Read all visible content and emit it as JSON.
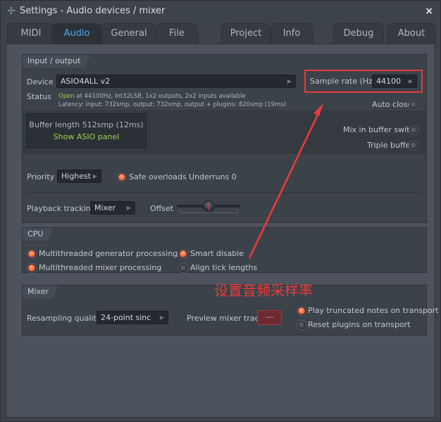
{
  "window": {
    "title": "Settings - Audio devices / mixer",
    "close_icon": "×",
    "app_icon": "✢"
  },
  "tabs": [
    {
      "label": "MIDI",
      "active": false
    },
    {
      "label": "Audio",
      "active": true
    },
    {
      "label": "General",
      "active": false
    },
    {
      "label": "File",
      "active": false
    },
    {
      "label": "Project",
      "active": false
    },
    {
      "label": "Info",
      "active": false
    },
    {
      "label": "Debug",
      "active": false
    },
    {
      "label": "About",
      "active": false
    }
  ],
  "input_output": {
    "section_label": "Input / output",
    "device_label": "Device",
    "device_value": "ASIO4ALL v2",
    "sample_rate_label": "Sample rate (Hz)",
    "sample_rate_value": "44100",
    "status_label": "Status",
    "status_open": "Open",
    "status_line1_rest": " at 44100Hz, Int32LSB, 1x2 outputs, 2x2 inputs available",
    "status_line2": "Latency: input: 732smp, output: 732smp, output + plugins: 820smp (19ms)",
    "auto_close_label": "Auto close",
    "auto_close_on": false,
    "buffer_length_label": "Buffer length 512smp (12ms)",
    "show_asio_panel_label": "Show ASIO panel",
    "mix_in_buffer_switch_label": "Mix in buffer switch",
    "mix_in_buffer_switch_on": false,
    "triple_buffer_label": "Triple buffer",
    "triple_buffer_on": false,
    "priority_label": "Priority",
    "priority_value": "Highest",
    "safe_overloads_label": "Safe overloads",
    "safe_overloads_on": true,
    "underruns_label": "Underruns 0",
    "playback_tracking_label": "Playback tracking",
    "playback_tracking_value": "Mixer",
    "offset_label": "Offset",
    "offset_value_fraction": 0.5
  },
  "cpu": {
    "section_label": "CPU",
    "options": [
      {
        "label": "Multithreaded generator processing",
        "on": true
      },
      {
        "label": "Multithreaded mixer processing",
        "on": true
      },
      {
        "label": "Smart disable",
        "on": true
      },
      {
        "label": "Align tick lengths",
        "on": false
      }
    ]
  },
  "mixer": {
    "section_label": "Mixer",
    "resampling_quality_label": "Resampling quality",
    "resampling_quality_value": "24-point sinc",
    "preview_mixer_track_label": "Preview mixer track",
    "preview_mixer_track_value": "---",
    "play_truncated_label": "Play truncated notes on transport",
    "play_truncated_on": true,
    "reset_plugins_label": "Reset plugins on transport",
    "reset_plugins_on": false
  },
  "annotation": {
    "text": "设置音频采样率",
    "color": "#ee3a3a"
  },
  "colors": {
    "accent_tab": "#4da8ec",
    "status_green": "#9fd14a",
    "radio_on": "#f2673e"
  }
}
